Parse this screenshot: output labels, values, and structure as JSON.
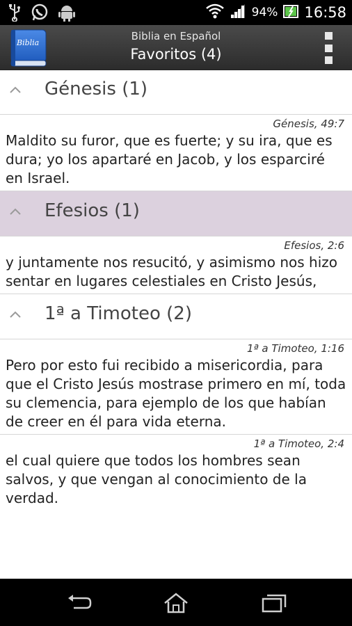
{
  "status_bar": {
    "battery_percent": "94%",
    "time": "16:58",
    "icons": [
      "usb-icon",
      "whatsapp-icon",
      "android-icon",
      "wifi-icon",
      "signal-icon",
      "battery-icon"
    ]
  },
  "action_bar": {
    "app_icon_label": "Biblia",
    "subtitle": "Biblia en Español",
    "title": "Favoritos (4)"
  },
  "groups": [
    {
      "title": "Génesis (1)",
      "selected": false,
      "verses": [
        {
          "ref": "Génesis, 49:7",
          "text": "Maldito su furor, que es fuerte; y su ira, que es dura; yo los apartaré en Jacob, y los esparciré en Israel."
        }
      ]
    },
    {
      "title": "Efesios (1)",
      "selected": true,
      "verses": [
        {
          "ref": "Efesios, 2:6",
          "text": "y juntamente nos resucitó, y asimismo nos hizo sentar en lugares celestiales en Cristo Jesús,"
        }
      ]
    },
    {
      "title": "1ª a Timoteo (2)",
      "selected": false,
      "verses": [
        {
          "ref": "1ª a Timoteo, 1:16",
          "text": "Pero por esto fui recibido a misericordia, para que el Cristo Jesús mostrase primero en mí, toda su clemencia, para ejemplo de los que habían de creer en él para vida eterna."
        },
        {
          "ref": "1ª a Timoteo, 2:4",
          "text": "el cual quiere que todos los hombres sean salvos, y que vengan al conocimiento de la verdad."
        }
      ]
    }
  ],
  "colors": {
    "selected_group_bg": "#dcd1de",
    "action_bar": "#3a3a3a",
    "app_icon_blue": "#2f6fd0"
  }
}
